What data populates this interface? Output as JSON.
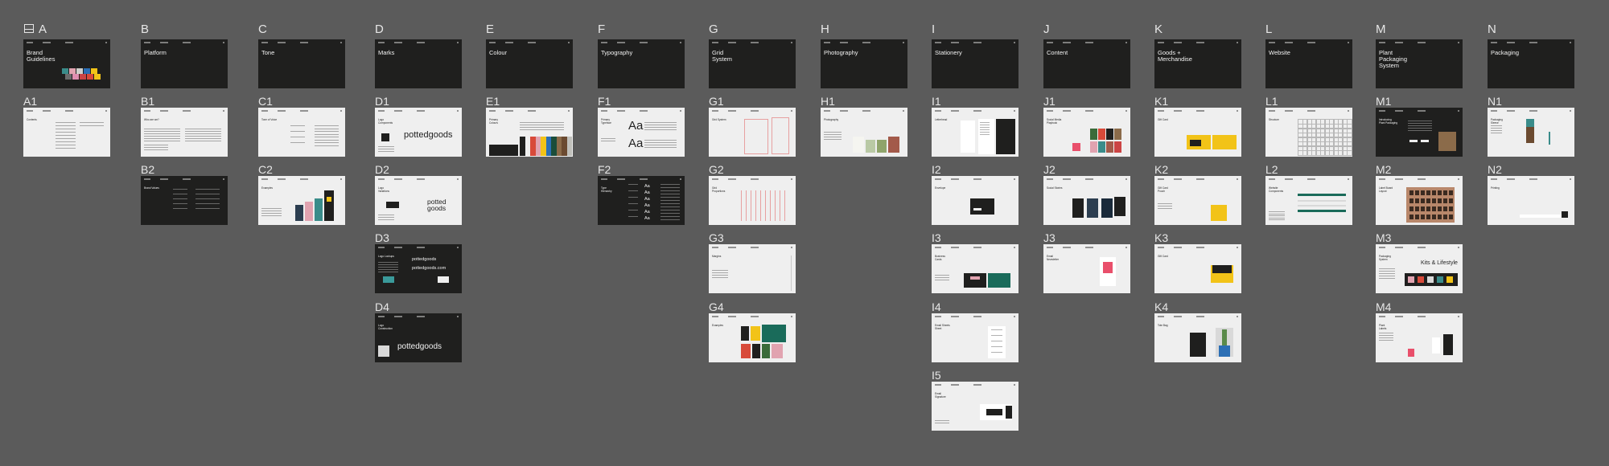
{
  "app": {
    "title": "Brand Guidelines canvas"
  },
  "sections": [
    {
      "letter": "A",
      "title": "Brand\nGuidelines"
    },
    {
      "letter": "B",
      "title": "Platform"
    },
    {
      "letter": "C",
      "title": "Tone"
    },
    {
      "letter": "D",
      "title": "Marks"
    },
    {
      "letter": "E",
      "title": "Colour"
    },
    {
      "letter": "F",
      "title": "Typography"
    },
    {
      "letter": "G",
      "title": "Grid\nSystem"
    },
    {
      "letter": "H",
      "title": "Photography"
    },
    {
      "letter": "I",
      "title": "Stationery"
    },
    {
      "letter": "J",
      "title": "Content"
    },
    {
      "letter": "K",
      "title": "Goods +\nMerchandise"
    },
    {
      "letter": "L",
      "title": "Website"
    },
    {
      "letter": "M",
      "title": "Plant\nPackaging\nSystem"
    },
    {
      "letter": "N",
      "title": "Packaging"
    }
  ],
  "frames": [
    {
      "id": "A1",
      "col": 0,
      "row": 1,
      "theme": "light",
      "title": "Contents"
    },
    {
      "id": "B1",
      "col": 1,
      "row": 1,
      "theme": "light",
      "title": "Who are we?"
    },
    {
      "id": "B2",
      "col": 1,
      "row": 2,
      "theme": "dark",
      "title": "Brand Values"
    },
    {
      "id": "C1",
      "col": 2,
      "row": 1,
      "theme": "light",
      "title": "Tone of Voice"
    },
    {
      "id": "C2",
      "col": 2,
      "row": 2,
      "theme": "light",
      "title": "Examples"
    },
    {
      "id": "D1",
      "col": 3,
      "row": 1,
      "theme": "light",
      "title": "Logo\nComponents",
      "big": "pottedgoods"
    },
    {
      "id": "D2",
      "col": 3,
      "row": 2,
      "theme": "light",
      "title": "Logo\nVariations",
      "big": "potted\ngoods"
    },
    {
      "id": "D3",
      "col": 3,
      "row": 3,
      "theme": "dark",
      "title": "Logo Lockups",
      "big": "pottedgoods\npottedgoods.com"
    },
    {
      "id": "D4",
      "col": 3,
      "row": 4,
      "theme": "dark",
      "title": "Logo\nConstruction",
      "big": "pottedgoods"
    },
    {
      "id": "E1",
      "col": 4,
      "row": 1,
      "theme": "light",
      "title": "Primary\nColours"
    },
    {
      "id": "F1",
      "col": 5,
      "row": 1,
      "theme": "light",
      "title": "Primary\nTypeface",
      "big": "Aa"
    },
    {
      "id": "F2",
      "col": 5,
      "row": 2,
      "theme": "dark",
      "title": "Type\nHierarchy",
      "big": "Aa"
    },
    {
      "id": "G1",
      "col": 6,
      "row": 1,
      "theme": "light",
      "title": "Grid System"
    },
    {
      "id": "G2",
      "col": 6,
      "row": 2,
      "theme": "light",
      "title": "Grid\nProportions"
    },
    {
      "id": "G3",
      "col": 6,
      "row": 3,
      "theme": "light",
      "title": "Margins"
    },
    {
      "id": "G4",
      "col": 6,
      "row": 4,
      "theme": "light",
      "title": "Examples"
    },
    {
      "id": "H1",
      "col": 7,
      "row": 1,
      "theme": "light",
      "title": "Photography"
    },
    {
      "id": "I1",
      "col": 8,
      "row": 1,
      "theme": "light",
      "title": "Letterhead"
    },
    {
      "id": "I2",
      "col": 8,
      "row": 2,
      "theme": "light",
      "title": "Envelope"
    },
    {
      "id": "I3",
      "col": 8,
      "row": 3,
      "theme": "light",
      "title": "Business\nCards"
    },
    {
      "id": "I4",
      "col": 8,
      "row": 4,
      "theme": "light",
      "title": "Email Sheets\nSheet"
    },
    {
      "id": "I5",
      "col": 8,
      "row": 5,
      "theme": "light",
      "title": "Email\nSignature"
    },
    {
      "id": "J1",
      "col": 9,
      "row": 1,
      "theme": "light",
      "title": "Social Media\nPlaybook"
    },
    {
      "id": "J2",
      "col": 9,
      "row": 2,
      "theme": "light",
      "title": "Social Stories"
    },
    {
      "id": "J3",
      "col": 9,
      "row": 3,
      "theme": "light",
      "title": "Email\nNewsletter"
    },
    {
      "id": "K1",
      "col": 10,
      "row": 1,
      "theme": "light",
      "title": "Gift Card"
    },
    {
      "id": "K2",
      "col": 10,
      "row": 2,
      "theme": "light",
      "title": "Gift Card\nPouch"
    },
    {
      "id": "K3",
      "col": 10,
      "row": 3,
      "theme": "light",
      "title": "Gift Card"
    },
    {
      "id": "K4",
      "col": 10,
      "row": 4,
      "theme": "light",
      "title": "Tote Bag"
    },
    {
      "id": "L1",
      "col": 11,
      "row": 1,
      "theme": "light",
      "title": "Structure"
    },
    {
      "id": "L2",
      "col": 11,
      "row": 2,
      "theme": "light",
      "title": "Website\nComponents"
    },
    {
      "id": "M1",
      "col": 12,
      "row": 1,
      "theme": "dark",
      "title": "Introducing\nPlant Packaging"
    },
    {
      "id": "M2",
      "col": 12,
      "row": 2,
      "theme": "light",
      "title": "Label Board\nLayout"
    },
    {
      "id": "M3",
      "col": 12,
      "row": 3,
      "theme": "light",
      "title": "Packaging\nSystem",
      "big": "Kits & Lifestyle"
    },
    {
      "id": "M4",
      "col": 12,
      "row": 4,
      "theme": "light",
      "title": "Plant\nLabels"
    },
    {
      "id": "N1",
      "col": 13,
      "row": 1,
      "theme": "light",
      "title": "Packaging\nSleeve"
    },
    {
      "id": "N2",
      "col": 13,
      "row": 2,
      "theme": "light",
      "title": "Printing"
    }
  ],
  "colors": {
    "canvas": "#5b5b5b",
    "dark_slide": "#1f1f1e",
    "light_slide": "#efefef",
    "label": "#e6e6e6"
  },
  "icons": {
    "page": "book-icon"
  }
}
